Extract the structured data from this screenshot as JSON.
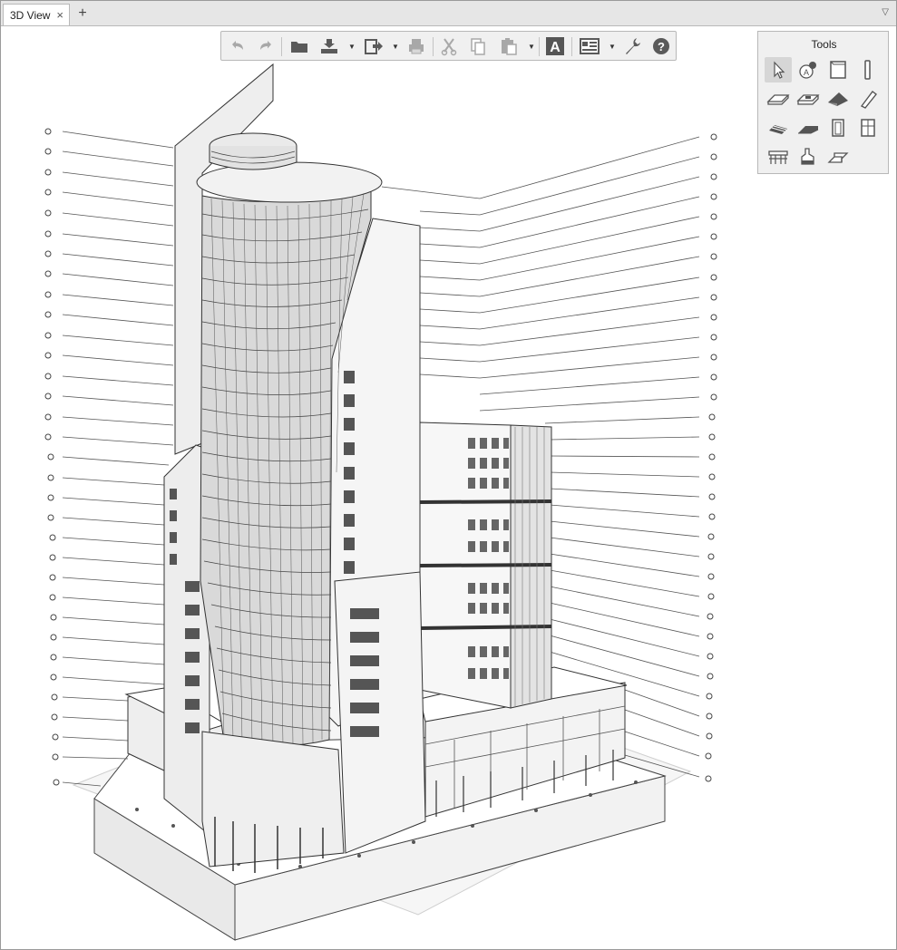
{
  "tabs": [
    {
      "label": "3D View",
      "close_glyph": "×"
    }
  ],
  "tab_add_glyph": "+",
  "tab_menu_glyph": "▽",
  "toolbar": {
    "buttons": [
      "undo-icon",
      "redo-icon",
      "open-icon",
      "import-icon",
      "export-icon",
      "print-icon",
      "cut-icon",
      "copy-icon",
      "paste-icon",
      "text-icon",
      "layout-icon",
      "settings-icon",
      "help-icon"
    ],
    "text_glyph": "A",
    "help_glyph": "?",
    "dropdown_glyph": "▼"
  },
  "tools_panel": {
    "title": "Tools",
    "tools": [
      "select-icon",
      "annotate-icon",
      "wall-icon",
      "column-icon",
      "slab-icon",
      "beam-icon",
      "roof-icon",
      "railing-icon",
      "stair-icon",
      "ramp-icon",
      "door-icon",
      "window-icon",
      "curtain-wall-icon",
      "object-icon",
      "shell-icon"
    ],
    "active": "select-icon"
  },
  "colors": {
    "tabbar": "#e6e6e6",
    "panel": "#f0f0f0",
    "icon": "#5a5a5a",
    "icon_disabled": "#a8a8a8",
    "help_blue": "#4a4a4a",
    "model_line": "#3a3a3a",
    "model_fill": "#f4f4f4"
  }
}
